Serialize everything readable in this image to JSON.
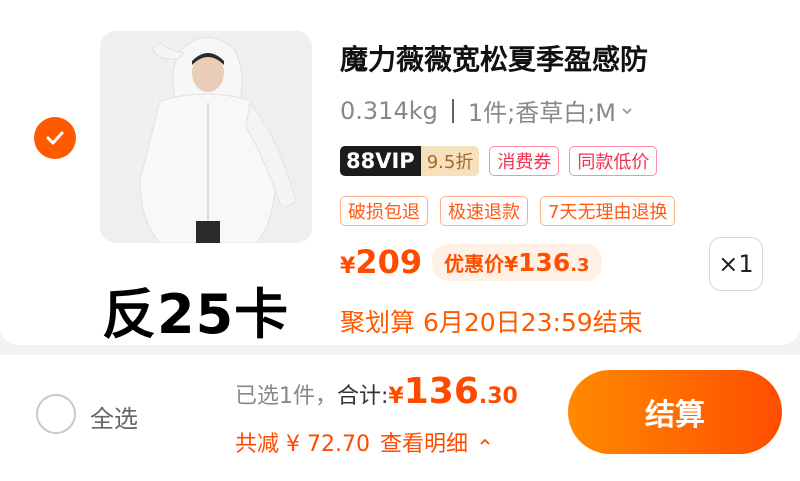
{
  "item": {
    "selected": true,
    "title": "魔力薇薇宽松夏季盈感防",
    "weight": "0.314kg",
    "variant": "1件;香草白;M",
    "vip_badge": "88VIP",
    "vip_discount": "9.5折",
    "tags": [
      "消费券",
      "同款低价"
    ],
    "service_tags": [
      "破损包退",
      "极速退款",
      "7天无理由退换"
    ],
    "price_symbol": "¥",
    "price": "209",
    "promo_label": "优惠价",
    "promo_symbol": "¥",
    "promo_int": "136",
    "promo_dec": ".3",
    "quantity": "×1",
    "countdown": "聚划算 6月20日23:59结束"
  },
  "overlay_text": "反25卡",
  "footer": {
    "select_all_label": "全选",
    "selected_count": "已选1件，",
    "total_label": "合计:",
    "total_symbol": "¥",
    "total_int": "136",
    "total_dec": ".30",
    "discount_text": "共减 ¥ 72.70",
    "detail_link": "查看明细",
    "checkout_label": "结算"
  },
  "colors": {
    "accent": "#ff5a00",
    "price": "#ff4b00",
    "tag_red": "#f2304f"
  },
  "icons": {
    "check": "check-icon",
    "chevron_down": "chevron-down-icon",
    "chevron_up": "chevron-up-icon"
  }
}
